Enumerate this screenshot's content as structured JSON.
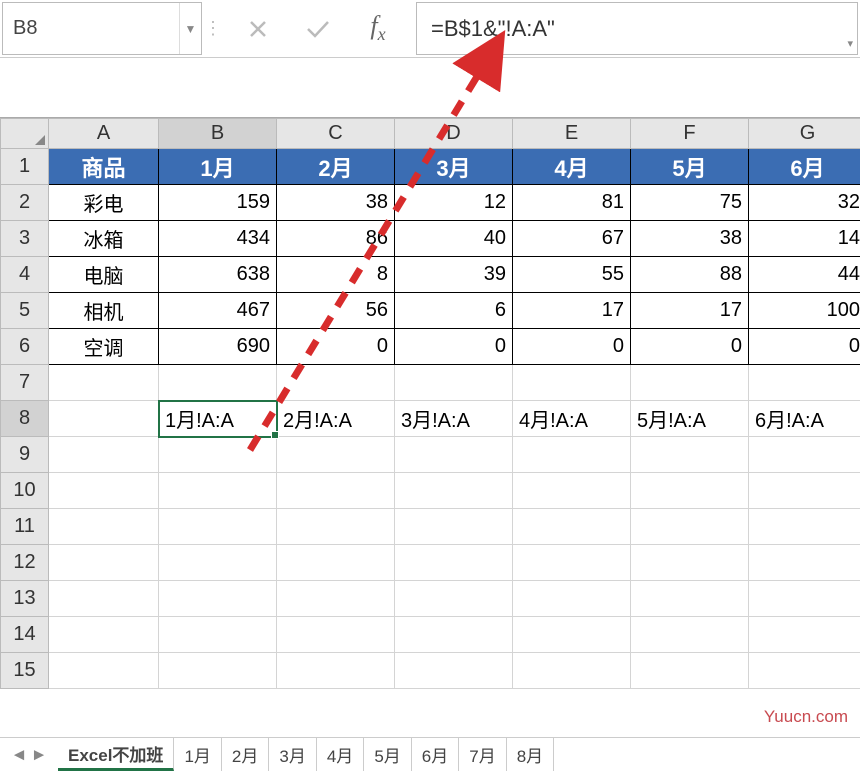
{
  "name_box": "B8",
  "formula": "=B$1&\"!A:A\"",
  "columns": [
    "A",
    "B",
    "C",
    "D",
    "E",
    "F",
    "G"
  ],
  "row_numbers": [
    1,
    2,
    3,
    4,
    5,
    6,
    7,
    8,
    9,
    10,
    11,
    12,
    13,
    14,
    15
  ],
  "header_row": [
    "商品",
    "1月",
    "2月",
    "3月",
    "4月",
    "5月",
    "6月"
  ],
  "data_rows": [
    {
      "label": "彩电",
      "vals": [
        159,
        38,
        12,
        81,
        75,
        32
      ]
    },
    {
      "label": "冰箱",
      "vals": [
        434,
        86,
        40,
        67,
        38,
        14
      ]
    },
    {
      "label": "电脑",
      "vals": [
        638,
        8,
        39,
        55,
        88,
        44
      ]
    },
    {
      "label": "相机",
      "vals": [
        467,
        56,
        6,
        17,
        17,
        100
      ]
    },
    {
      "label": "空调",
      "vals": [
        690,
        0,
        0,
        0,
        0,
        0
      ]
    }
  ],
  "formula_row": [
    "1月!A:A",
    "2月!A:A",
    "3月!A:A",
    "4月!A:A",
    "5月!A:A",
    "6月!A:A"
  ],
  "active_cell": {
    "row": 8,
    "col": "B"
  },
  "sheet_tabs": [
    "Excel不加班",
    "1月",
    "2月",
    "3月",
    "4月",
    "5月",
    "6月",
    "7月",
    "8月"
  ],
  "active_sheet": "Excel不加班",
  "watermark": "Yuucn.com"
}
